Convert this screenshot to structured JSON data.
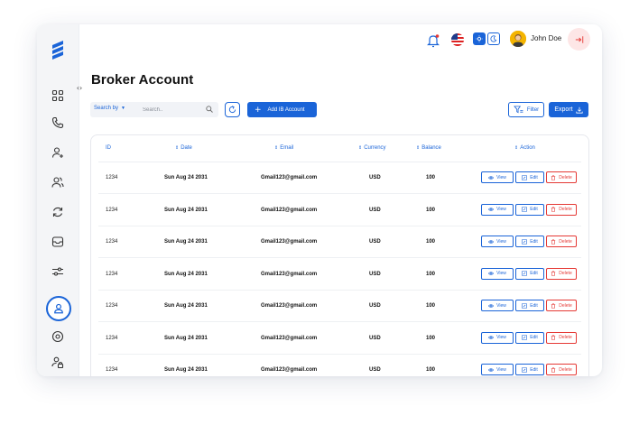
{
  "header": {
    "user_name": "John Doe",
    "icons": [
      "bell-icon",
      "us-flag-icon",
      "sun-icon",
      "moon-icon",
      "user-avatar",
      "logout-icon"
    ]
  },
  "sidebar": {
    "items": [
      "dashboard-icon",
      "phone-icon",
      "user-add-icon",
      "users-icon",
      "sync-icon",
      "inbox-icon",
      "sliders-icon",
      "account-icon",
      "settings-icon",
      "user-lock-icon"
    ],
    "active": "account-icon"
  },
  "page": {
    "title": "Broker Account"
  },
  "toolbar": {
    "search_by_label": "Search by",
    "search_placeholder": "Search..",
    "add_button": "Add IB Account",
    "filter_button": "Filter",
    "export_button": "Export"
  },
  "table": {
    "columns": {
      "id": "ID",
      "date": "Date",
      "email": "Email",
      "currency": "Currency",
      "balance": "Balance",
      "action": "Action"
    },
    "rows": [
      {
        "id": "1234",
        "date": "Sun Aug 24 2031",
        "email": "Gmail123@gmail.com",
        "currency": "USD",
        "balance": "100"
      },
      {
        "id": "1234",
        "date": "Sun Aug 24 2031",
        "email": "Gmail123@gmail.com",
        "currency": "USD",
        "balance": "100"
      },
      {
        "id": "1234",
        "date": "Sun Aug 24 2031",
        "email": "Gmail123@gmail.com",
        "currency": "USD",
        "balance": "100"
      },
      {
        "id": "1234",
        "date": "Sun Aug 24 2031",
        "email": "Gmail123@gmail.com",
        "currency": "USD",
        "balance": "100"
      },
      {
        "id": "1234",
        "date": "Sun Aug 24 2031",
        "email": "Gmail123@gmail.com",
        "currency": "USD",
        "balance": "100"
      },
      {
        "id": "1234",
        "date": "Sun Aug 24 2031",
        "email": "Gmail123@gmail.com",
        "currency": "USD",
        "balance": "100"
      },
      {
        "id": "1234",
        "date": "Sun Aug 24 2031",
        "email": "Gmail123@gmail.com",
        "currency": "USD",
        "balance": "100"
      }
    ],
    "actions": {
      "view": "View",
      "edit": "Edit",
      "delete": "Delete"
    }
  },
  "colors": {
    "primary": "#1a64d8",
    "danger": "#e53935",
    "sidebar_bg": "#f4f5f7"
  }
}
